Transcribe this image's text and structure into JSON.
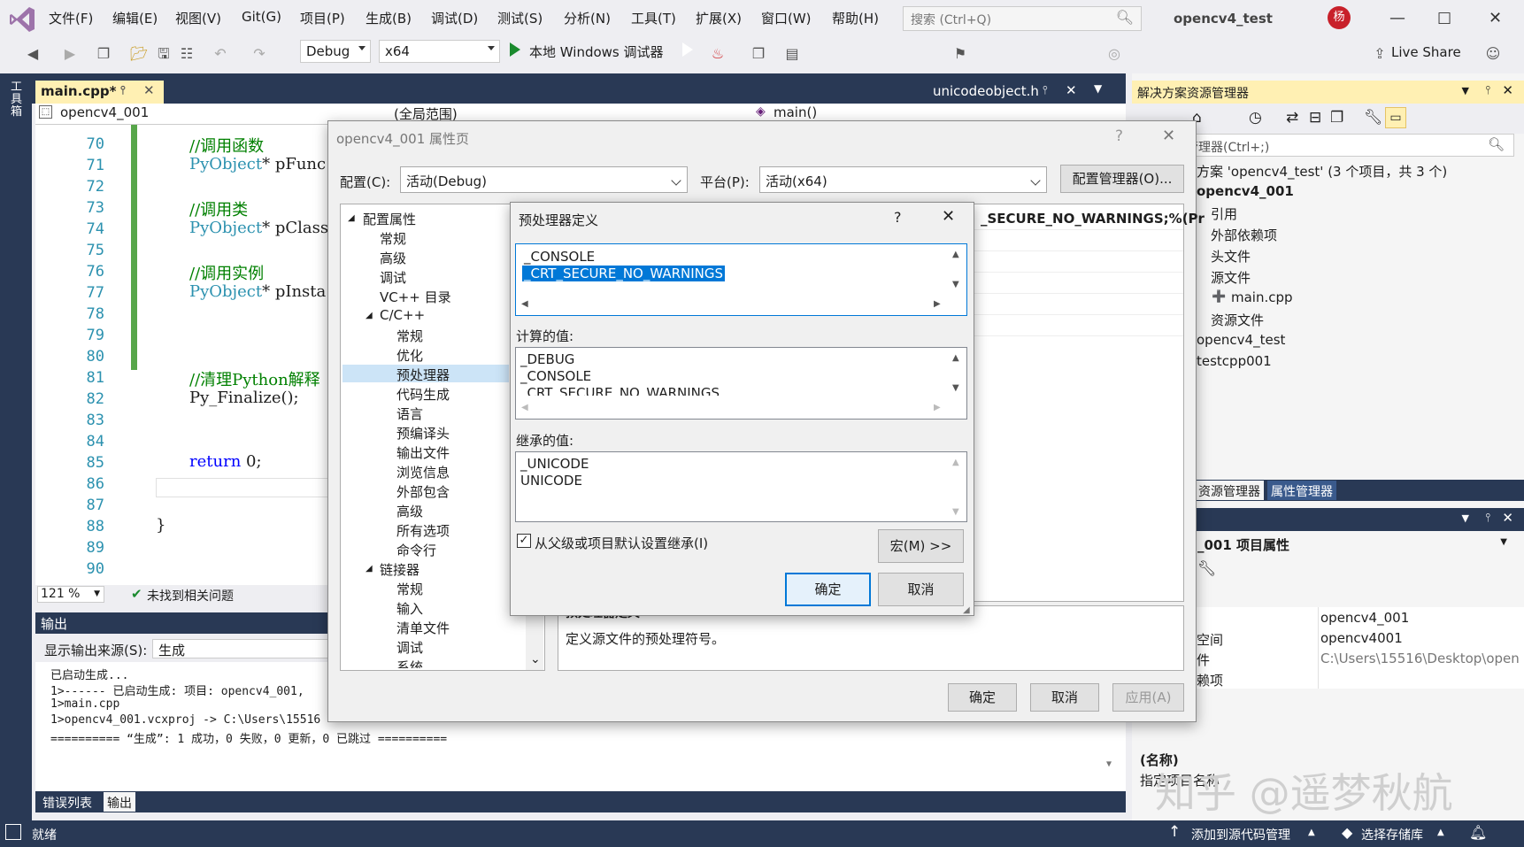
{
  "menubar": {
    "items": [
      "文件(F)",
      "编辑(E)",
      "视图(V)",
      "Git(G)",
      "项目(P)",
      "生成(B)",
      "调试(D)",
      "测试(S)",
      "分析(N)",
      "工具(T)",
      "扩展(X)",
      "窗口(W)",
      "帮助(H)"
    ],
    "search_placeholder": "搜索 (Ctrl+Q)",
    "project_title": "opencv4_test",
    "avatar": "杨"
  },
  "toolbar": {
    "config": "Debug",
    "platform": "x64",
    "debugger_label": "本地 Windows 调试器",
    "live_share": "Live Share"
  },
  "left_toolbox_label": "工具箱",
  "editor": {
    "tab_active": "main.cpp*",
    "tab_right": "unicodeobject.h",
    "nav_project": "opencv4_001",
    "nav_scope": "(全局范围)",
    "nav_func": "main()",
    "line_numbers": [
      "70",
      "71",
      "72",
      "73",
      "74",
      "75",
      "76",
      "77",
      "78",
      "79",
      "80",
      "81",
      "82",
      "83",
      "84",
      "85",
      "86",
      "87",
      "88",
      "89",
      "90"
    ],
    "code": {
      "l70": "//调用函数",
      "l71_type": "PyObject",
      "l71_rest": "* pFunc",
      "l73": "//调用类",
      "l74_type": "PyObject",
      "l74_rest": "* pClass",
      "l76": "//调用实例",
      "l77_type": "PyObject",
      "l77_rest": "* pInsta",
      "l81": "//清理Python解释",
      "l82": "Py_Finalize();",
      "l85_kw": "return",
      "l85_rest": " 0;",
      "l88": "}"
    },
    "zoom": "121 %",
    "issues": "未找到相关问题"
  },
  "output": {
    "title": "输出",
    "source_label": "显示输出来源(S):",
    "source_value": "生成",
    "lines": [
      "已启动生成...",
      "1>------ 已启动生成: 项目: opencv4_001,",
      "1>main.cpp",
      "1>opencv4_001.vcxproj -> C:\\Users\\15516",
      "========== “生成”: 1 成功，0 失败，0 更新，0 已跳过 =========="
    ],
    "tab_errors": "错误列表",
    "tab_output": "输出"
  },
  "statusbar": {
    "ready": "就绪",
    "add_source": "添加到源代码管理",
    "select_repo": "选择存储库"
  },
  "solution_explorer": {
    "title": "解决方案资源管理器",
    "search": "方案资源管理器(Ctrl+;)",
    "items": [
      "方案 'opencv4_test' (3 个项目，共 3 个)",
      "opencv4_001",
      "引用",
      "外部依赖项",
      "头文件",
      "源文件",
      "main.cpp",
      "资源文件",
      "opencv4_test",
      "testcpp001"
    ],
    "tab_explorer": "资源管理器",
    "tab_props": "属性管理器"
  },
  "properties": {
    "header": "_001 项目属性",
    "rows": [
      {
        "key": "",
        "value": "opencv4_001"
      },
      {
        "key": "空间",
        "value": "opencv4001"
      },
      {
        "key": "件",
        "value": "C:\\Users\\15516\\Desktop\\open"
      },
      {
        "key": "赖项",
        "value": ""
      }
    ],
    "name_label": "(名称)",
    "name_desc": "指定项目名称"
  },
  "property_pages": {
    "title": "opencv4_001 属性页",
    "config_label": "配置(C):",
    "config_value": "活动(Debug)",
    "platform_label": "平台(P):",
    "platform_value": "活动(x64)",
    "config_manager": "配置管理器(O)...",
    "tree": [
      "配置属性",
      "常规",
      "高级",
      "调试",
      "VC++ 目录",
      "C/C++",
      "常规",
      "优化",
      "预处理器",
      "代码生成",
      "语言",
      "预编译头",
      "输出文件",
      "浏览信息",
      "外部包含",
      "高级",
      "所有选项",
      "命令行",
      "链接器",
      "常规",
      "输入",
      "清单文件",
      "调试",
      "系统"
    ],
    "grid_value_fragment": "_SECURE_NO_WARNINGS;%(Pr",
    "desc_title": "预处理器定义",
    "desc_text": "定义源文件的预处理符号。",
    "ok": "确定",
    "cancel": "取消",
    "apply": "应用(A)"
  },
  "preprocessor_dialog": {
    "title": "预处理器定义",
    "help": "?",
    "edit_lines": [
      "_CONSOLE",
      "_CRT_SECURE_NO_WARNINGS"
    ],
    "computed_label": "计算的值:",
    "computed_lines": [
      "_DEBUG",
      "_CONSOLE",
      "_CRT_SECURE_NO_WARNINGS"
    ],
    "inherited_label": "继承的值:",
    "inherited_lines": [
      "_UNICODE",
      "UNICODE"
    ],
    "inherit_checkbox": "从父级或项目默认设置继承(I)",
    "inherit_checked": true,
    "macros": "宏(M) >>",
    "ok": "确定",
    "cancel": "取消"
  },
  "watermark": "知乎 @遥梦秋航"
}
